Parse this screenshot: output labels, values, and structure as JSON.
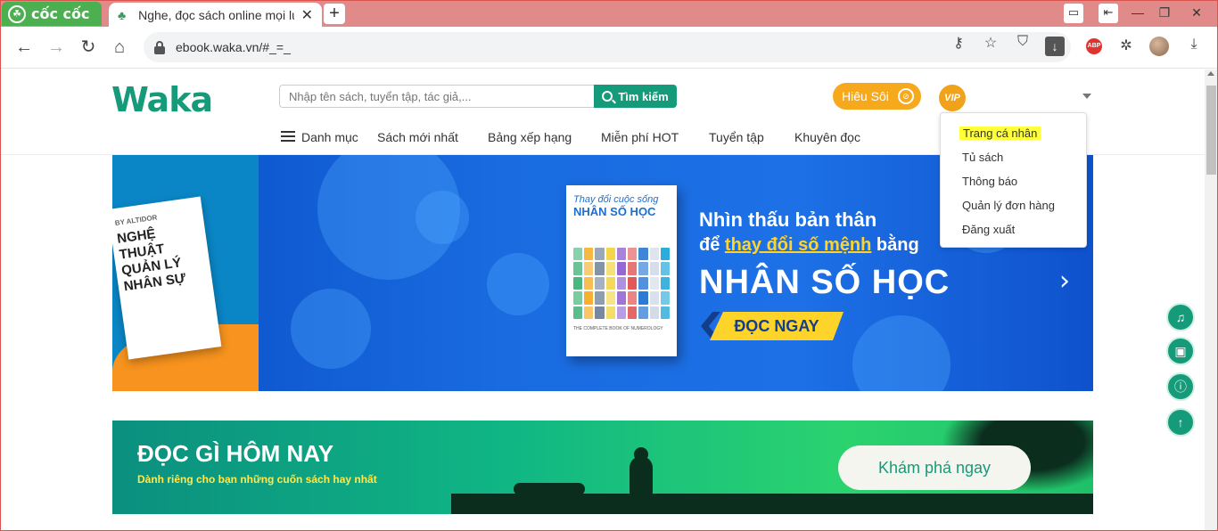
{
  "browser": {
    "brand_name": "cốc cốc",
    "tab_title": "Nghe, đọc sách online mọi lúc",
    "tab_close": "✕",
    "new_tab": "+",
    "url": "ebook.waka.vn/#_=_",
    "abp_label": "ABP",
    "window_controls": {
      "minimize": "—",
      "maximize": "❐",
      "close": "✕"
    }
  },
  "site": {
    "logo_text": "Waka",
    "search": {
      "placeholder": "Nhập tên sách, tuyển tập, tác giả,...",
      "button_label": "Tìm kiếm"
    },
    "hieusoi_label": "Hiêu Sôi",
    "vip_label": "VIP",
    "nav": {
      "menu_label": "Danh mục",
      "items": [
        "Sách mới nhất",
        "Bảng xếp hạng",
        "Miễn phí HOT",
        "Tuyển tập",
        "Khuyên đọc"
      ]
    },
    "account_menu": {
      "items": [
        "Trang cá nhân",
        "Tủ sách",
        "Thông báo",
        "Quản lý đơn hàng",
        "Đăng xuất"
      ],
      "highlighted_index": 0
    }
  },
  "banner": {
    "left_book": {
      "author": "BY ALTIDOR",
      "title": "NGHỆ THUẬT QUẢN LÝ NHÂN SỰ"
    },
    "main_book": {
      "title_line1": "Thay đổi cuộc sống",
      "title_line2": "NHÂN SỐ HỌC",
      "footer": "THE COMPLETE BOOK OF NUMEROLOGY"
    },
    "headline_line1": "Nhìn thấu bản thân",
    "headline_line2_prefix": "để ",
    "headline_line2_highlight": "thay đổi số mệnh",
    "headline_line2_suffix": " bằng",
    "headline_line3": "NHÂN SỐ HỌC",
    "cta": "ĐỌC NGAY",
    "next": "›"
  },
  "promo": {
    "title": "ĐỌC GÌ HÔM NAY",
    "subtitle": "Dành riêng cho bạn những cuốn sách hay nhất",
    "cta": "Khám phá ngay"
  },
  "fabs": [
    "headphones-icon",
    "image-icon",
    "info-icon",
    "arrow-up-icon"
  ],
  "colors": {
    "brand": "#169b7a",
    "accent": "#f7a91d",
    "highlight": "#ffff3b",
    "tab_strip": "#e08a8a"
  }
}
